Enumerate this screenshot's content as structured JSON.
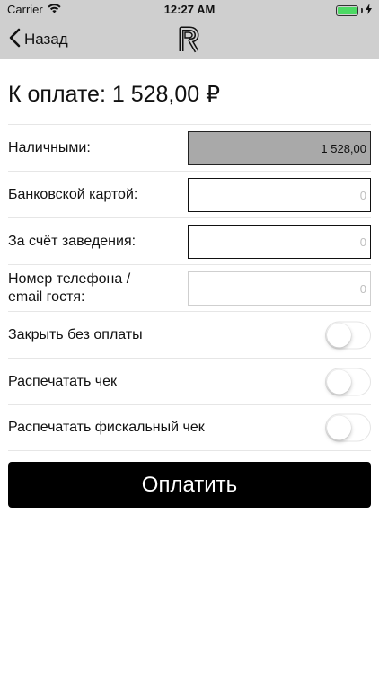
{
  "status_bar": {
    "carrier": "Carrier",
    "time": "12:27 AM"
  },
  "nav": {
    "back_label": "Назад",
    "logo_icon": "restaurant-r-logo-icon"
  },
  "amount": {
    "title": "К оплате: 1 528,00 ₽"
  },
  "fields": [
    {
      "label": "Наличными:",
      "value": "1 528,00",
      "placeholder": ""
    },
    {
      "label": "Банковской картой:",
      "value": "",
      "placeholder": "0"
    },
    {
      "label": "За счёт заведения:",
      "value": "",
      "placeholder": "0"
    },
    {
      "label": "Номер телефона / email гостя:",
      "value": "",
      "placeholder": "0"
    }
  ],
  "toggles": [
    {
      "label": "Закрыть без оплаты",
      "on": false
    },
    {
      "label": "Распечатать чек",
      "on": false
    },
    {
      "label": "Распечатать фискальный чек",
      "on": false
    }
  ],
  "pay_button": {
    "label": "Оплатить"
  },
  "colors": {
    "nav_bg": "#cfcfcf",
    "active_field_bg": "#a9a9a9",
    "battery_fill": "#4cd964",
    "pay_button_bg": "#000000"
  }
}
